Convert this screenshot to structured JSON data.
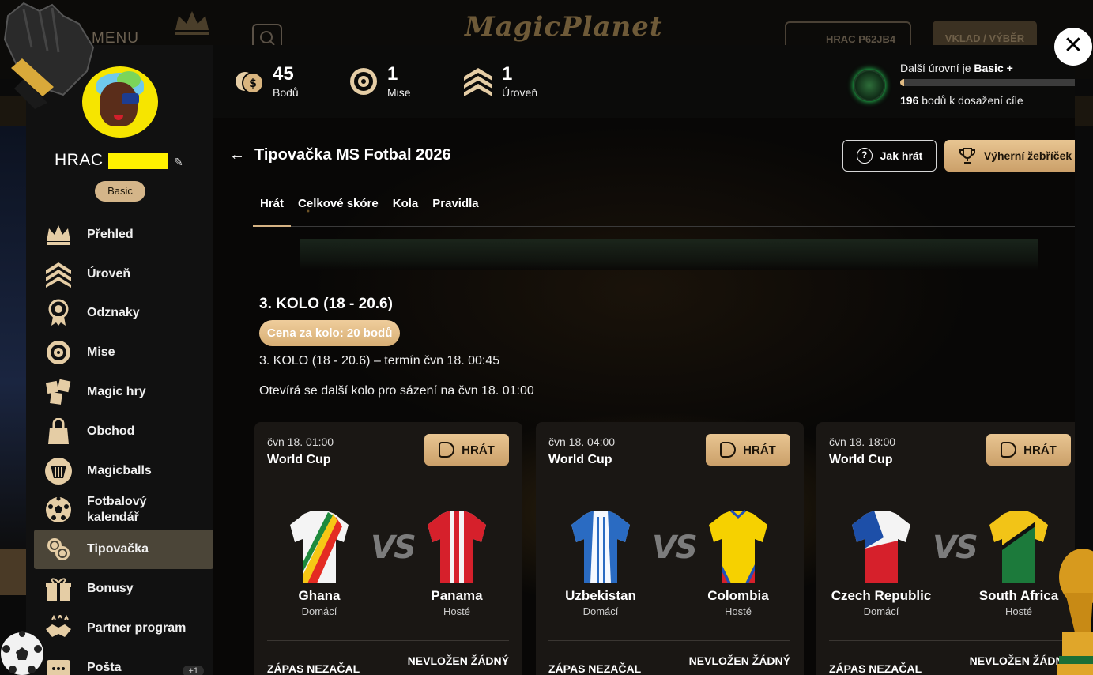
{
  "background": {
    "menu_label": "MENU",
    "logo_text": "MagicPlanet",
    "user_button": "HRAC P62JB4",
    "deposit_button": "VKLAD / VÝBĚR"
  },
  "profile": {
    "username": "HRAC",
    "level": "Basic"
  },
  "nav": {
    "items": [
      {
        "label": "Přehled",
        "icon": "crown-icon"
      },
      {
        "label": "Úroveň",
        "icon": "chevrons-icon"
      },
      {
        "label": "Odznaky",
        "icon": "badge-icon"
      },
      {
        "label": "Mise",
        "icon": "target-icon"
      },
      {
        "label": "Magic hry",
        "icon": "puzzle-icon"
      },
      {
        "label": "Obchod",
        "icon": "bag-icon"
      },
      {
        "label": "Magicballs",
        "icon": "magicball-icon"
      },
      {
        "label": "Fotbalový kalendář",
        "icon": "football-icon"
      },
      {
        "label": "Tipovačka",
        "icon": "coins-icon"
      },
      {
        "label": "Bonusy",
        "icon": "gift-icon"
      },
      {
        "label": "Partner program",
        "icon": "handshake-icon"
      },
      {
        "label": "Pošta",
        "icon": "mail-icon",
        "badge": "+1"
      }
    ],
    "active_index": 8
  },
  "stats": {
    "points": {
      "value": "45",
      "label": "Bodů"
    },
    "missions": {
      "value": "1",
      "label": "Mise"
    },
    "level": {
      "value": "1",
      "label": "Úroveň"
    }
  },
  "next_level": {
    "prefix": "Další úrovní je",
    "name": "Basic +",
    "points": "196",
    "points_suffix": "bodů k dosažení cíle",
    "progress_percent": 2
  },
  "page": {
    "title": "Tipovačka MS Fotbal 2026",
    "how_to_play": "Jak hrát",
    "leaderboard": "Výherní žebříček",
    "tabs": [
      "Hrát",
      "Celkové skóre",
      "Kola",
      "Pravidla"
    ],
    "active_tab": 0
  },
  "round": {
    "title": "3. KOLO (18 - 20.6)",
    "price": "Cena za kolo: 20 bodů",
    "deadline": "3. KOLO (18 - 20.6) – termín čvn 18. 00:45",
    "next_round": "Otevírá se další kolo pro sázení na čvn 18. 01:00"
  },
  "matches": [
    {
      "date": "čvn 18. 01:00",
      "league": "World Cup",
      "play": "HRÁT",
      "home": "Ghana",
      "home_role": "Domácí",
      "away": "Panama",
      "away_role": "Hosté",
      "status": "ZÁPAS NEZAČAL",
      "tip": "NEVLOŽEN ŽÁDNÝ"
    },
    {
      "date": "čvn 18. 04:00",
      "league": "World Cup",
      "play": "HRÁT",
      "home": "Uzbekistan",
      "home_role": "Domácí",
      "away": "Colombia",
      "away_role": "Hosté",
      "status": "ZÁPAS NEZAČAL",
      "tip": "NEVLOŽEN ŽÁDNÝ"
    },
    {
      "date": "čvn 18. 18:00",
      "league": "World Cup",
      "play": "HRÁT",
      "home": "Czech Republic",
      "home_role": "Domácí",
      "away": "South Africa",
      "away_role": "Hosté",
      "status": "ZÁPAS NEZAČAL",
      "tip": "NEVLOŽEN ŽÁDNÝ"
    }
  ],
  "vs_label": "VS",
  "colors": {
    "accent": "#d9b57f",
    "background": "#0b0a09",
    "active_nav": "#4b4538"
  }
}
